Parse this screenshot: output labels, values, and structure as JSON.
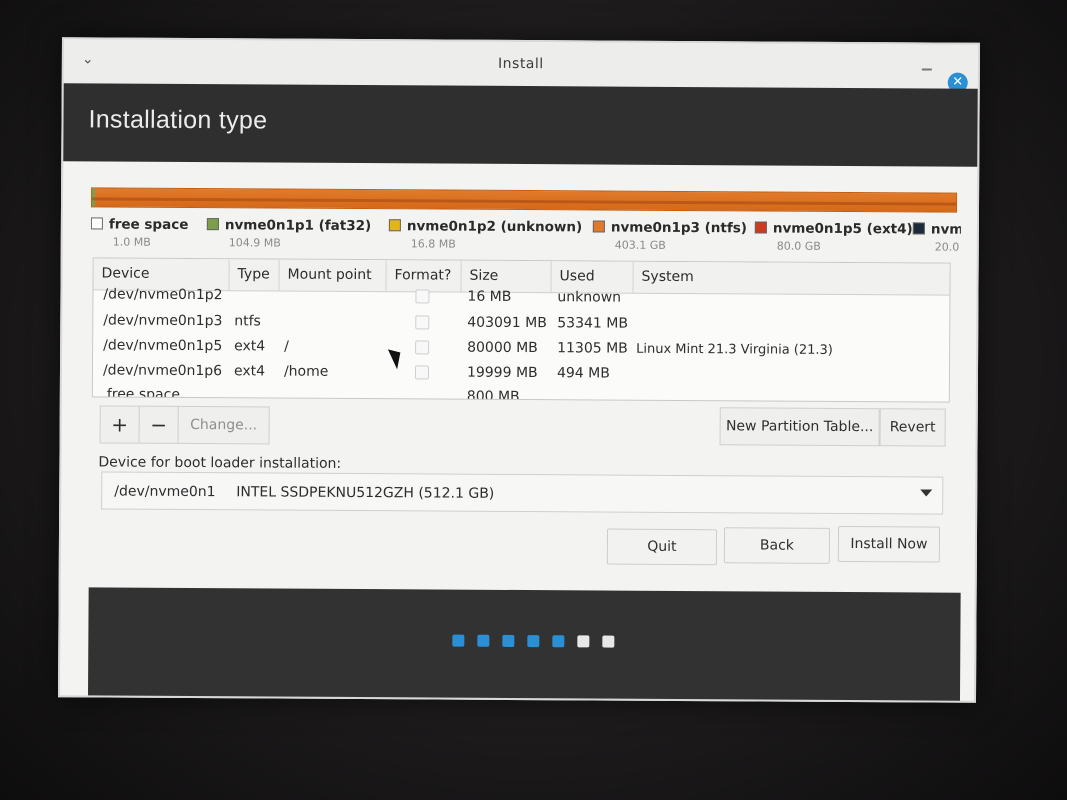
{
  "window": {
    "title": "Install"
  },
  "header": {
    "title": "Installation type"
  },
  "legend": [
    {
      "name": "free space",
      "size": "1.0 MB",
      "color": "#ffffff"
    },
    {
      "name": "nvme0n1p1 (fat32)",
      "size": "104.9 MB",
      "color": "#7d9e4a"
    },
    {
      "name": "nvme0n1p2 (unknown)",
      "size": "16.8 MB",
      "color": "#e3b51c"
    },
    {
      "name": "nvme0n1p3 (ntfs)",
      "size": "403.1 GB",
      "color": "#e07a2a"
    },
    {
      "name": "nvme0n1p5 (ext4)",
      "size": "80.0 GB",
      "color": "#cc3a1f"
    },
    {
      "name": "nvm",
      "size": "20.0",
      "color": "#1e2a3a"
    }
  ],
  "table": {
    "columns": [
      "Device",
      "Type",
      "Mount point",
      "Format?",
      "Size",
      "Used",
      "System"
    ],
    "rows": [
      {
        "device": "/dev/nvme0n1p2",
        "type": "",
        "mount": "",
        "size": "16 MB",
        "used": "unknown",
        "system": ""
      },
      {
        "device": "/dev/nvme0n1p3",
        "type": "ntfs",
        "mount": "",
        "size": "403091 MB",
        "used": "53341 MB",
        "system": ""
      },
      {
        "device": "/dev/nvme0n1p5",
        "type": "ext4",
        "mount": "/",
        "size": "80000 MB",
        "used": "11305 MB",
        "system": "Linux Mint 21.3 Virginia (21.3)"
      },
      {
        "device": "/dev/nvme0n1p6",
        "type": "ext4",
        "mount": "/home",
        "size": "19999 MB",
        "used": "494 MB",
        "system": ""
      },
      {
        "device": "free space",
        "type": "",
        "mount": "",
        "size": "800 MB",
        "used": "",
        "system": ""
      }
    ]
  },
  "toolbar": {
    "add_label": "+",
    "remove_label": "−",
    "change_label": "Change...",
    "new_table_label": "New Partition Table...",
    "revert_label": "Revert"
  },
  "bootloader": {
    "label": "Device for boot loader installation:",
    "device": "/dev/nvme0n1",
    "model": "INTEL SSDPEKNU512GZH (512.1 GB)"
  },
  "buttons": {
    "quit": "Quit",
    "back": "Back",
    "install": "Install Now"
  },
  "progress": {
    "total_steps": 7,
    "completed_steps": 5,
    "active_color": "#2a8fd4",
    "inactive_color": "#e8e8e8"
  }
}
